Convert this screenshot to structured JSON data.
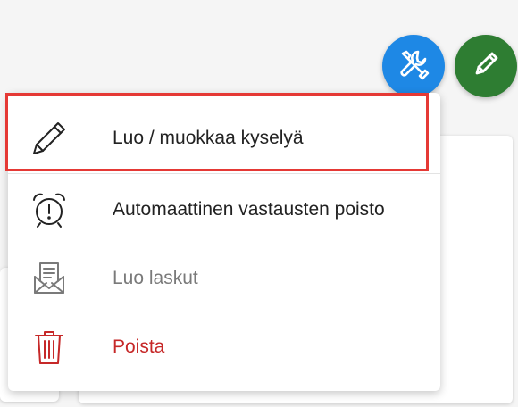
{
  "colors": {
    "tools_fab": "#1e88e5",
    "edit_fab": "#2e7d32",
    "highlight": "#e53935",
    "danger": "#c62828",
    "disabled": "#7a7a7a"
  },
  "fabs": [
    {
      "name": "tools-fab",
      "icon": "tools-icon"
    },
    {
      "name": "edit-fab",
      "icon": "pencil-icon"
    }
  ],
  "menu": {
    "items": [
      {
        "label": "Luo / muokkaa kyselyä",
        "icon": "pencil-icon",
        "state": "highlighted"
      },
      {
        "label": "Automaattinen vastausten poisto",
        "icon": "alarm-clock-icon",
        "state": "normal"
      },
      {
        "label": "Luo laskut",
        "icon": "envelope-document-icon",
        "state": "disabled"
      },
      {
        "label": "Poista",
        "icon": "trash-icon",
        "state": "danger"
      }
    ]
  }
}
